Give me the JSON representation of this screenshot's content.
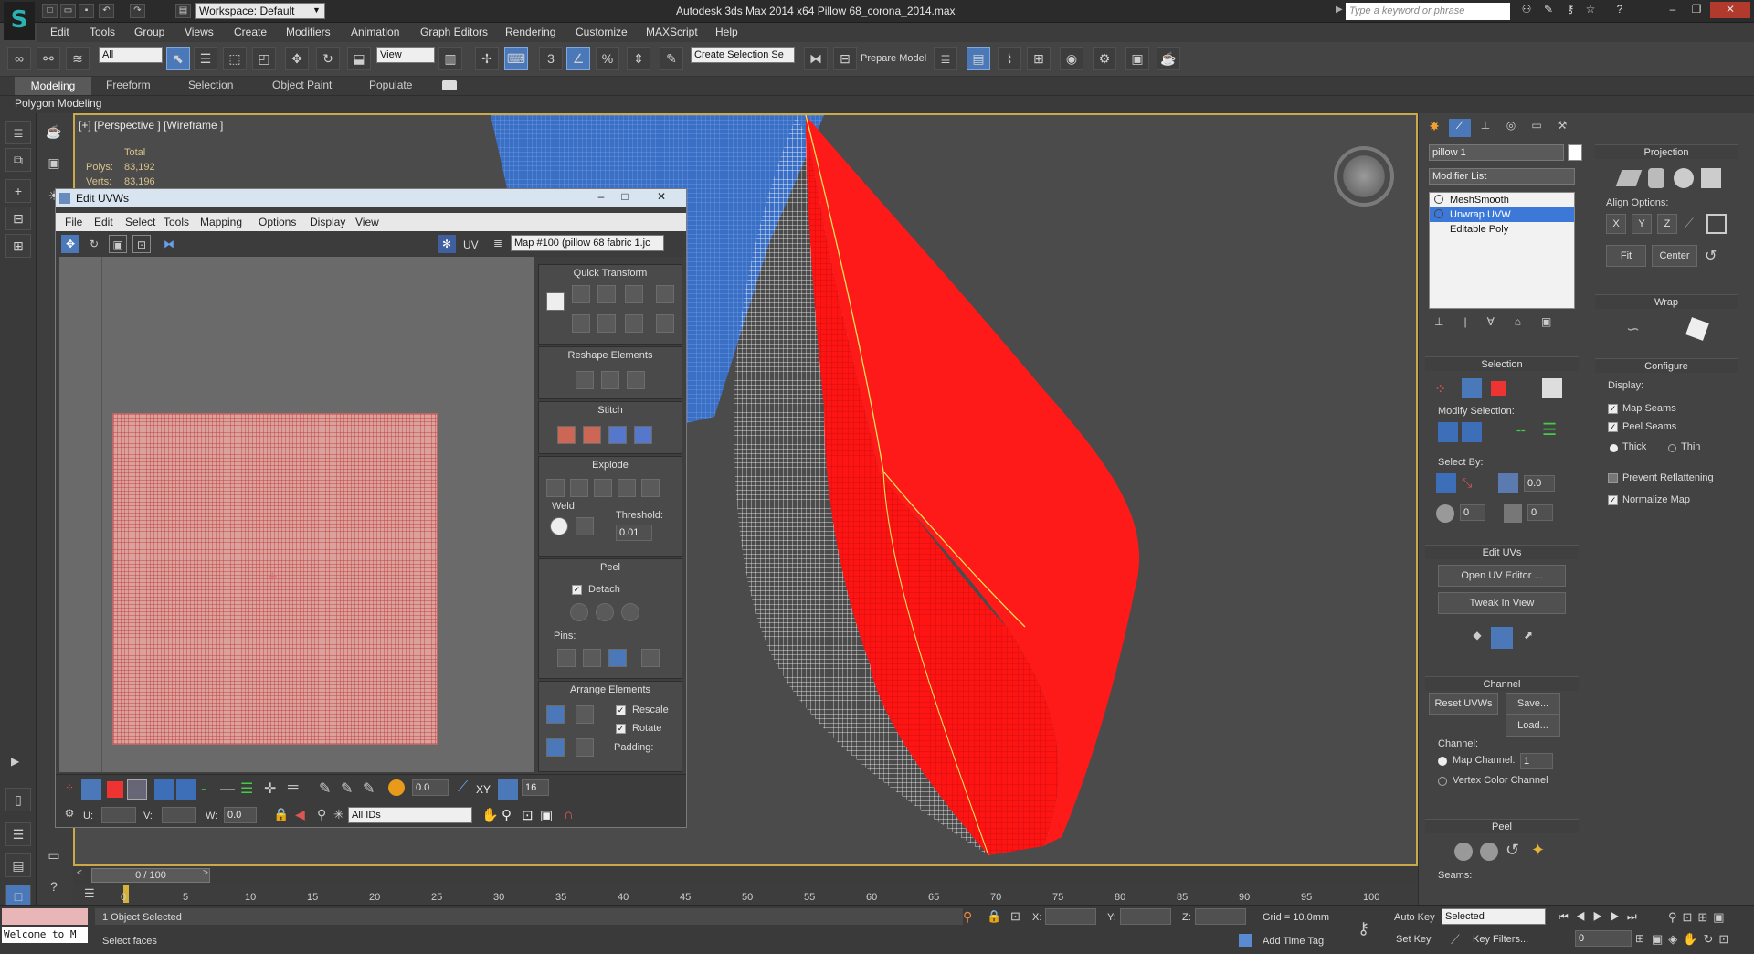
{
  "app": {
    "title": "Autodesk 3ds Max  2014 x64     Pillow 68_corona_2014.max",
    "workspace": "Workspace: Default",
    "search_placeholder": "Type a keyword or phrase"
  },
  "menu": [
    "Edit",
    "Tools",
    "Group",
    "Views",
    "Create",
    "Modifiers",
    "Animation",
    "Graph Editors",
    "Rendering",
    "Customize",
    "MAXScript",
    "Help"
  ],
  "toolbar": {
    "selection_filter": "All",
    "ref_coord": "View",
    "named_selection": "Create Selection Se",
    "prepare_model": "Prepare Model"
  },
  "ribbon": {
    "tabs": [
      "Modeling",
      "Freeform",
      "Selection",
      "Object Paint",
      "Populate"
    ],
    "active_tab": "Modeling",
    "panel": "Polygon Modeling"
  },
  "viewport": {
    "label": "[+] [Perspective ] [Wireframe ]",
    "stats_total": "Total",
    "polys_label": "Polys:",
    "polys_value": "83,192",
    "verts_label": "Verts:",
    "verts_value": "83,196"
  },
  "uv_editor": {
    "title": "Edit UVWs",
    "menu": [
      "File",
      "Edit",
      "Select",
      "Tools",
      "Mapping",
      "Options",
      "Display",
      "View"
    ],
    "uv_label": "UV",
    "map_select": "Map #100 (pillow 68 fabric 1.jc",
    "quick_transform": "Quick Transform",
    "reshape": "Reshape Elements",
    "stitch": "Stitch",
    "explode": "Explode",
    "weld": "Weld",
    "threshold_label": "Threshold:",
    "threshold_value": "0.01",
    "peel": "Peel",
    "detach": "Detach",
    "pins": "Pins:",
    "arrange": "Arrange Elements",
    "rescale": "Rescale",
    "rotate": "Rotate",
    "padding": "Padding:",
    "soft_value": "0.0",
    "xy_label": "XY",
    "grid_count": "16",
    "u_label": "U:",
    "v_label": "V:",
    "w_label": "W:",
    "w_value": "0.0",
    "ids_select": "All IDs"
  },
  "command_panel": {
    "object_name": "pillow 1",
    "modifier_list": "Modifier List",
    "stack": [
      {
        "name": "MeshSmooth",
        "selected": false
      },
      {
        "name": "Unwrap UVW",
        "selected": true
      },
      {
        "name": "Editable Poly",
        "selected": false
      }
    ],
    "selection_title": "Selection",
    "modify_selection": "Modify Selection:",
    "select_by": "Select By:",
    "angle_value": "0.0",
    "spin_a": "0",
    "spin_b": "0",
    "edit_uvs": "Edit UVs",
    "open_uv_editor": "Open UV Editor ...",
    "tweak_in_view": "Tweak In View",
    "channel_title": "Channel",
    "reset_uvws": "Reset UVWs",
    "save": "Save...",
    "load": "Load...",
    "channel_label": "Channel:",
    "map_channel": "Map Channel:",
    "map_channel_value": "1",
    "vertex_color_channel": "Vertex Color Channel",
    "peel_title": "Peel",
    "seams": "Seams:",
    "projection_title": "Projection",
    "align_options": "Align Options:",
    "align_x": "X",
    "align_y": "Y",
    "align_z": "Z",
    "fit": "Fit",
    "center": "Center",
    "wrap_title": "Wrap",
    "configure_title": "Configure",
    "display_label": "Display:",
    "map_seams": "Map Seams",
    "peel_seams": "Peel Seams",
    "thick": "Thick",
    "thin": "Thin",
    "prevent_reflattening": "Prevent Reflattening",
    "normalize_map": "Normalize Map"
  },
  "timeline": {
    "frame": "0 / 100",
    "ticks": [
      "0",
      "5",
      "10",
      "15",
      "20",
      "25",
      "30",
      "35",
      "40",
      "45",
      "50",
      "55",
      "60",
      "65",
      "70",
      "75",
      "80",
      "85",
      "90",
      "95",
      "100"
    ]
  },
  "status": {
    "objects_selected": "1 Object Selected",
    "prompt": "Select faces",
    "listener": "Welcome to M",
    "x_label": "X:",
    "y_label": "Y:",
    "z_label": "Z:",
    "grid": "Grid = 10.0mm",
    "add_time_tag": "Add Time Tag",
    "auto_key": "Auto Key",
    "set_key": "Set Key",
    "key_mode": "Selected",
    "key_filters": "Key Filters...",
    "frame_value": "0"
  },
  "colors": {
    "accent": "#4a78b8",
    "viewport_border": "#c9a94a",
    "mesh_red": "#ff1010",
    "mesh_blue": "#4a7fd0"
  }
}
